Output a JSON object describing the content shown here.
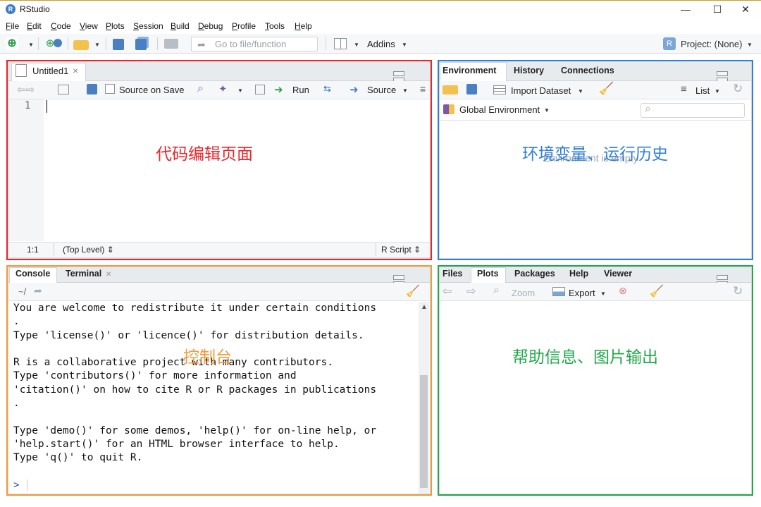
{
  "window": {
    "title": "RStudio",
    "logo_letter": "R",
    "controls": {
      "minimize": "—",
      "maximize": "☐",
      "close": "✕"
    }
  },
  "menu": [
    {
      "key": "F",
      "rest": "ile"
    },
    {
      "key": "E",
      "rest": "dit"
    },
    {
      "key": "C",
      "rest": "ode"
    },
    {
      "key": "V",
      "rest": "iew"
    },
    {
      "key": "P",
      "rest": "lots"
    },
    {
      "key": "S",
      "rest": "ession"
    },
    {
      "key": "B",
      "rest": "uild"
    },
    {
      "key": "D",
      "rest": "ebug"
    },
    {
      "key": "P",
      "rest": "rofile"
    },
    {
      "key": "T",
      "rest": "ools"
    },
    {
      "key": "H",
      "rest": "elp"
    }
  ],
  "toolbar": {
    "goto_placeholder": "Go to file/function",
    "addins_label": "Addins",
    "project_label": "Project: (None)"
  },
  "source_pane": {
    "tab_label": "Untitled1",
    "tab_close": "×",
    "source_on_save": "Source on Save",
    "run_label": "Run",
    "source_label": "Source",
    "line_number": "1",
    "status_position": "1:1",
    "status_scope": "(Top Level)",
    "status_type": "R Script",
    "updown": "⇕"
  },
  "env_pane": {
    "tabs": [
      "Environment",
      "History",
      "Connections"
    ],
    "import_dataset": "Import Dataset",
    "list_label": "List",
    "global_env": "Global Environment",
    "empty_message": "Environment is empty"
  },
  "console_pane": {
    "tabs": [
      "Console",
      "Terminal"
    ],
    "terminal_close": "×",
    "path": "~/",
    "lines": [
      "You are welcome to redistribute it under certain conditions",
      ".",
      "Type 'license()' or 'licence()' for distribution details.",
      "",
      "R is a collaborative project with many contributors.",
      "Type 'contributors()' for more information and",
      "'citation()' on how to cite R or R packages in publications",
      ".",
      "",
      "Type 'demo()' for some demos, 'help()' for on-line help, or",
      "'help.start()' for an HTML browser interface to help.",
      "Type 'q()' to quit R."
    ],
    "prompt": ">"
  },
  "files_pane": {
    "tabs": [
      "Files",
      "Plots",
      "Packages",
      "Help",
      "Viewer"
    ],
    "zoom_label": "Zoom",
    "export_label": "Export"
  },
  "annotations": {
    "editor": "代码编辑页面",
    "environment": "环境变量、运行历史",
    "console": "控制台",
    "help": "帮助信息、图片输出"
  },
  "colors": {
    "editor_outline": "#e8262b",
    "environment_outline": "#2f7fd6",
    "console_outline": "#f59a3a",
    "help_outline": "#22a84a"
  }
}
